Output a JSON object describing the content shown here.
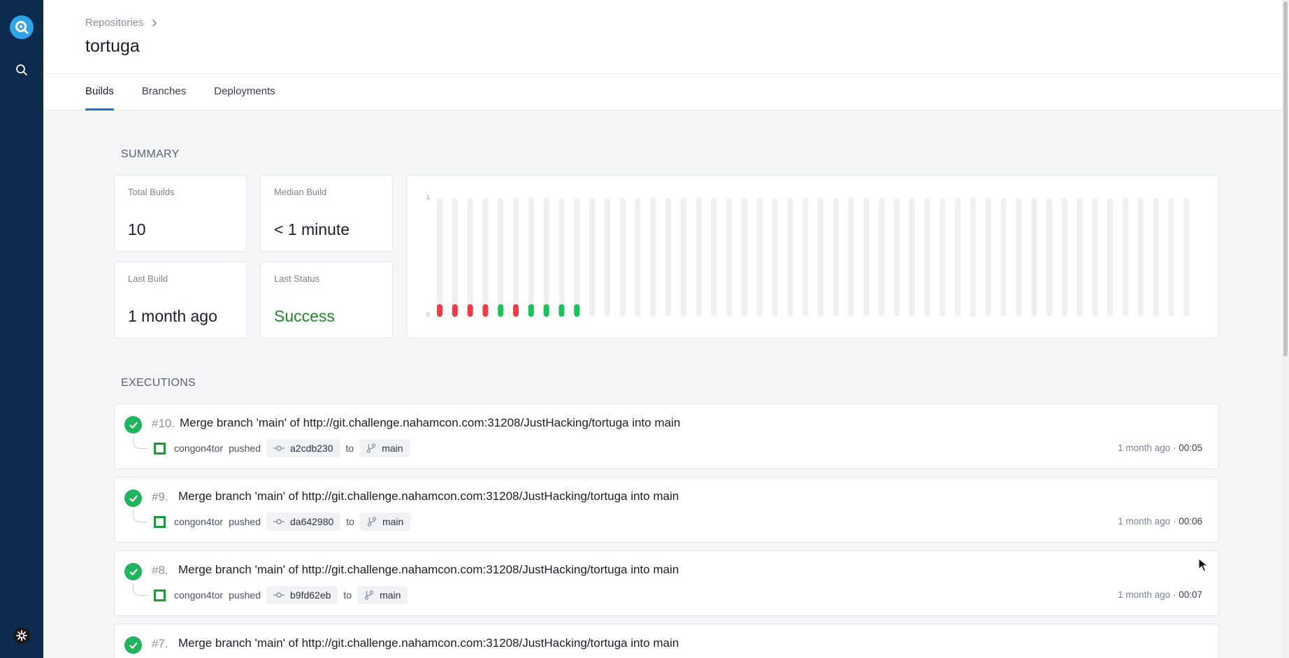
{
  "breadcrumb": {
    "parent": "Repositories"
  },
  "repo": {
    "name": "tortuga"
  },
  "tabs": [
    {
      "label": "Builds",
      "active": true
    },
    {
      "label": "Branches",
      "active": false
    },
    {
      "label": "Deployments",
      "active": false
    }
  ],
  "summary": {
    "heading": "SUMMARY",
    "total_builds": {
      "label": "Total Builds",
      "value": "10"
    },
    "median_build": {
      "label": "Median Build",
      "value": "< 1 minute"
    },
    "last_build": {
      "label": "Last Build",
      "value": "1 month ago"
    },
    "last_status": {
      "label": "Last Status",
      "value": "Success"
    }
  },
  "chart_data": {
    "type": "bar",
    "y_ticks": [
      "1",
      "0"
    ],
    "ylim": [
      0,
      1
    ],
    "slots": 50,
    "builds": [
      "failure",
      "failure",
      "failure",
      "failure",
      "success",
      "failure",
      "success",
      "success",
      "success",
      "success"
    ],
    "colors": {
      "success": "#1fbf5b",
      "failure": "#ef3b45",
      "empty": "#eef0f4"
    }
  },
  "executions": {
    "heading": "EXECUTIONS",
    "items": [
      {
        "number": "#10.",
        "message": "Merge branch 'main' of http://git.challenge.nahamcon.com:31208/JustHacking/tortuga into main",
        "author": "congon4tor",
        "action": "pushed",
        "commit": "a2cdb230",
        "to": "to",
        "branch": "main",
        "ago": "1 month ago",
        "sep": "·",
        "duration": "00:05"
      },
      {
        "number": "#9.",
        "message": "Merge branch 'main' of http://git.challenge.nahamcon.com:31208/JustHacking/tortuga into main",
        "author": "congon4tor",
        "action": "pushed",
        "commit": "da642980",
        "to": "to",
        "branch": "main",
        "ago": "1 month ago",
        "sep": "·",
        "duration": "00:06"
      },
      {
        "number": "#8.",
        "message": "Merge branch 'main' of http://git.challenge.nahamcon.com:31208/JustHacking/tortuga into main",
        "author": "congon4tor",
        "action": "pushed",
        "commit": "b9fd62eb",
        "to": "to",
        "branch": "main",
        "ago": "1 month ago",
        "sep": "·",
        "duration": "00:07"
      },
      {
        "number": "#7.",
        "message": "Merge branch 'main' of http://git.challenge.nahamcon.com:31208/JustHacking/tortuga into main"
      }
    ]
  }
}
